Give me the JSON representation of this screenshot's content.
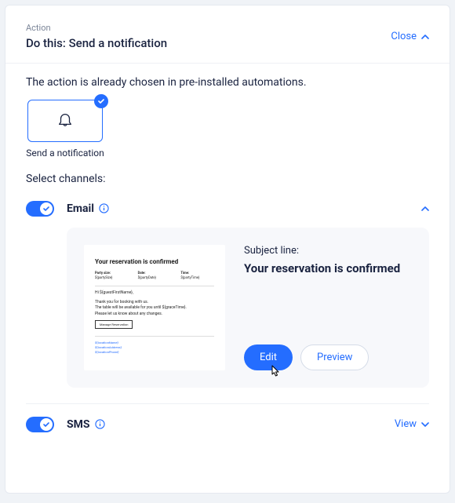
{
  "header": {
    "kicker": "Action",
    "title": "Do this: Send a notification",
    "close_label": "Close"
  },
  "description": "The action is already chosen in pre-installed automations.",
  "action_tile": {
    "label": "Send a notification"
  },
  "select_channels_label": "Select channels:",
  "channels": {
    "email": {
      "label": "Email",
      "enabled": true,
      "subject_label": "Subject line:",
      "subject_value": "Your reservation is confirmed",
      "edit_label": "Edit",
      "preview_label": "Preview",
      "thumb": {
        "title": "Your reservation is confirmed",
        "party_h": "Party size:",
        "party_v": "${partySize}",
        "date_h": "Date:",
        "date_v": "${partyDate}",
        "time_h": "Time:",
        "time_v": "${partyTime}",
        "greeting": "Hi ${guestFirstName},",
        "l1": "Thank you for booking with us.",
        "l2": "The table will be available for you until ${graceTime}.",
        "l3": "Please let us know about any changes.",
        "btn": "Manage Reservation",
        "link1": "${locationName}",
        "link2": "${locationAddress}",
        "link3": "${locationPhone}"
      }
    },
    "sms": {
      "label": "SMS",
      "enabled": true,
      "view_label": "View"
    }
  }
}
